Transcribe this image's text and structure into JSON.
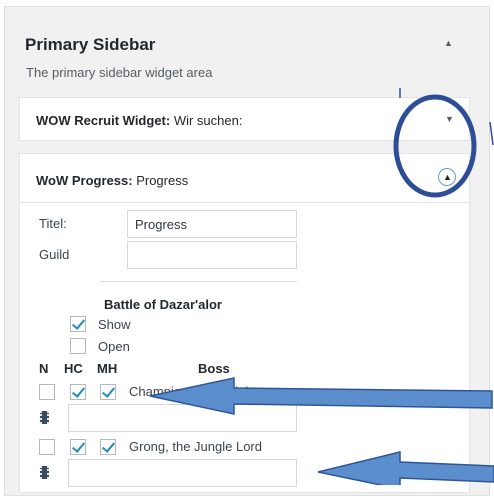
{
  "sidebar": {
    "title": "Primary Sidebar",
    "description": "The primary sidebar widget area"
  },
  "widgets": [
    {
      "type_label": "WOW Recruit Widget:",
      "instance_title": "Wir suchen:"
    },
    {
      "type_label": "WoW Progress:",
      "instance_title": "Progress"
    }
  ],
  "form": {
    "title_label": "Titel:",
    "title_value": "Progress",
    "guild_label": "Guild",
    "guild_value": ""
  },
  "raid": {
    "name": "Battle of Dazar'alor",
    "show_label": "Show",
    "show_checked": true,
    "open_label": "Open",
    "open_checked": false,
    "columns": [
      "N",
      "HC",
      "MH",
      "Boss"
    ],
    "bosses": [
      {
        "name": "Champion of the Light",
        "n": false,
        "hc": true,
        "mh": true
      },
      {
        "name": "Grong, the Jungle Lord",
        "n": false,
        "hc": true,
        "mh": true
      }
    ]
  },
  "annotation_colors": {
    "circle": "#2d4e96",
    "arrow_fill": "#5b8ecc",
    "arrow_stroke": "#2f5597"
  }
}
